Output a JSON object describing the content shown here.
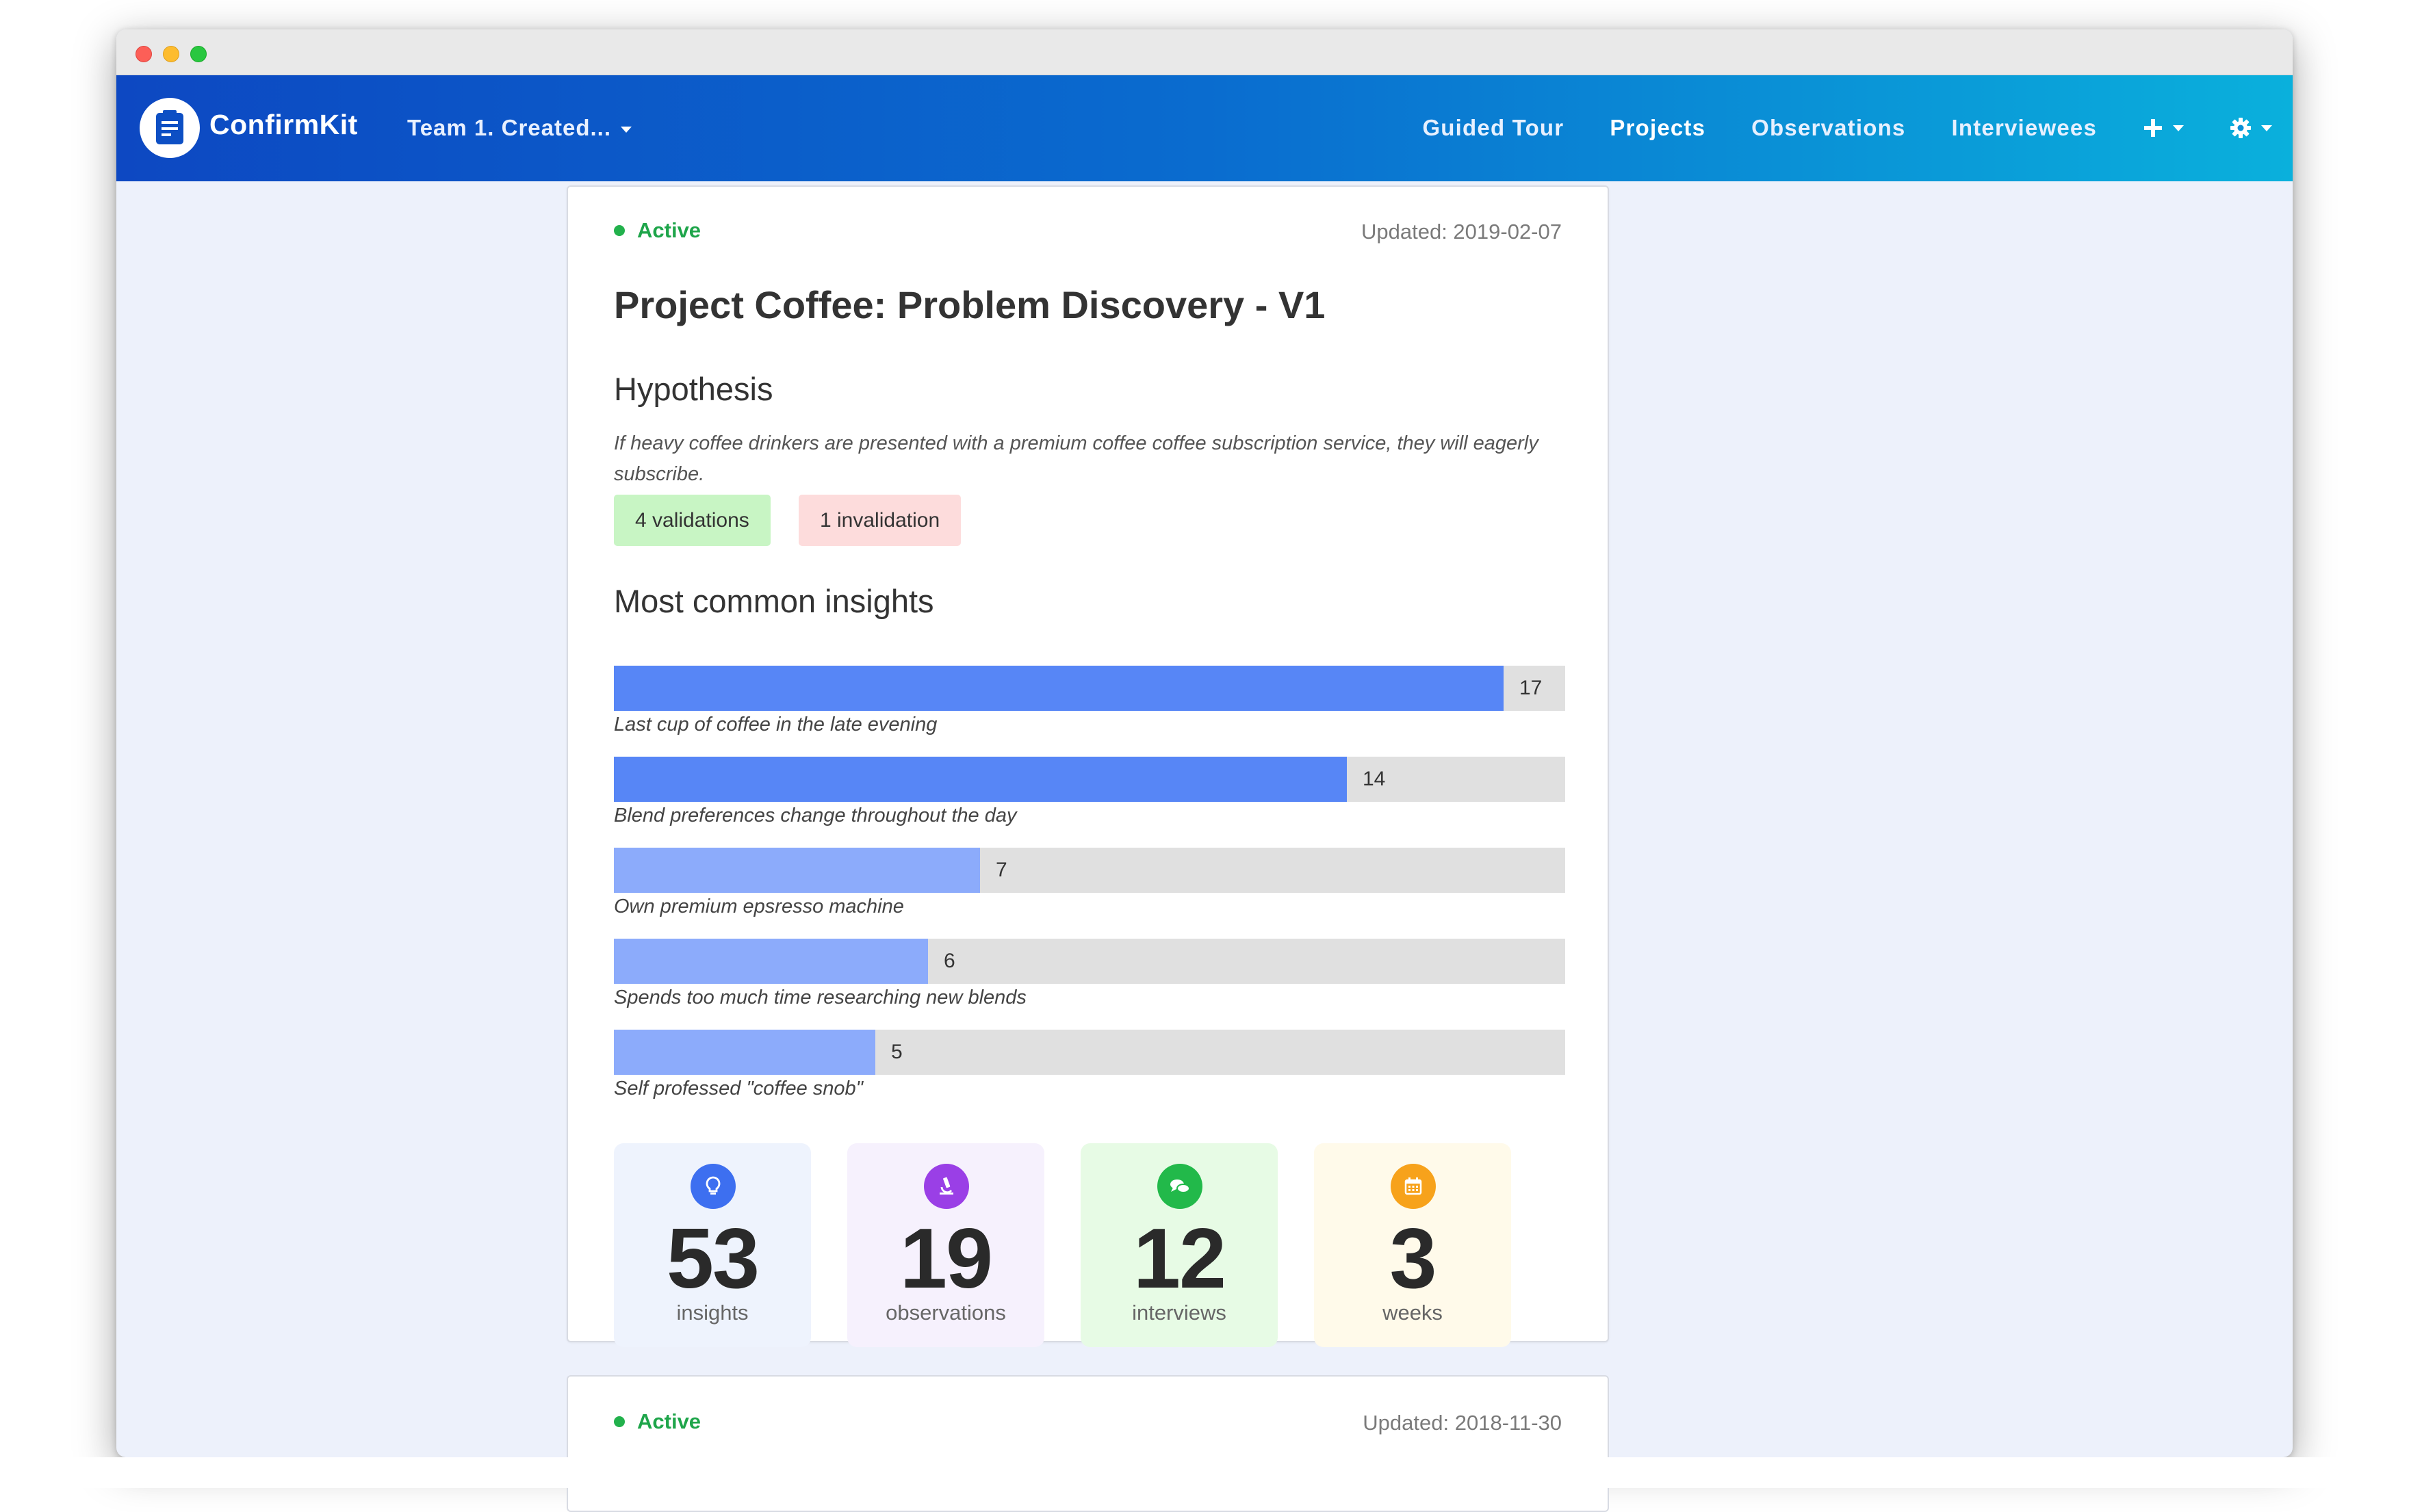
{
  "app": {
    "brand": "ConfirmKit",
    "team_selector": "Team 1. Created..."
  },
  "nav": {
    "links": [
      "Guided Tour",
      "Projects",
      "Observations",
      "Interviewees"
    ],
    "active": "Projects",
    "add_icon": "plus-icon",
    "settings_icon": "gear-icon"
  },
  "project": {
    "status": "Active",
    "updated": "Updated: 2019-02-07",
    "title": "Project Coffee: Problem Discovery - V1",
    "hypothesis_heading": "Hypothesis",
    "hypothesis": "If heavy coffee drinkers are presented with a premium coffee coffee subscription service, they will eagerly subscribe.",
    "validations": "4 validations",
    "invalidations": "1 invalidation",
    "insights_heading": "Most common insights",
    "insights": [
      {
        "label": "Last cup of coffee in the late evening",
        "value": 17
      },
      {
        "label": "Blend preferences change throughout the day",
        "value": 14
      },
      {
        "label": "Own premium epsresso machine",
        "value": 7
      },
      {
        "label": "Spends too much time researching new blends",
        "value": 6
      },
      {
        "label": "Self professed \"coffee snob\"",
        "value": 5
      }
    ],
    "stats": [
      {
        "number": "53",
        "label": "insights",
        "icon": "lightbulb-icon",
        "color": "#3d6ff0",
        "bg": "#eef3fd"
      },
      {
        "number": "19",
        "label": "observations",
        "icon": "microscope-icon",
        "color": "#9a3fe6",
        "bg": "#f6f1fd"
      },
      {
        "number": "12",
        "label": "interviews",
        "icon": "chat-bubbles-icon",
        "color": "#22b94a",
        "bg": "#e7fbe5"
      },
      {
        "number": "3",
        "label": "weeks",
        "icon": "calendar-icon",
        "color": "#f7a21b",
        "bg": "#fffaea"
      }
    ]
  },
  "project2": {
    "status": "Active",
    "updated": "Updated: 2018-11-30"
  },
  "colors": {
    "bar_primary": "#5786f6",
    "bar_secondary": "#8cabfb",
    "bar_track": "#e0e0e0",
    "status_green": "#22b14c"
  }
}
